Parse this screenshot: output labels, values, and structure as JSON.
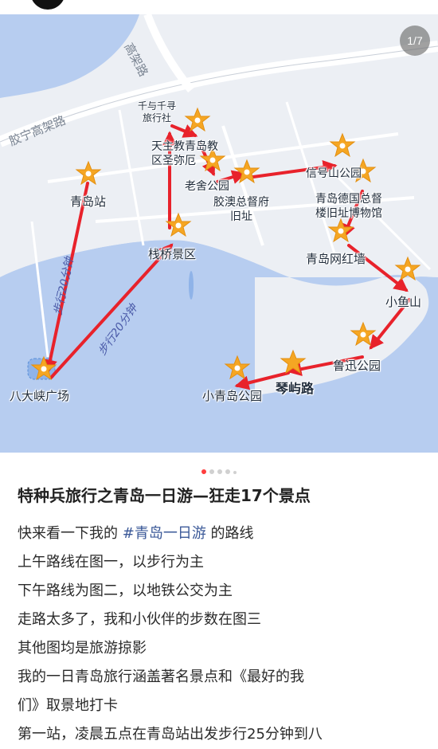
{
  "image_counter": "1/7",
  "map": {
    "roads": [
      "高架路",
      "胶宁高架路"
    ],
    "walk_labels": [
      "步行20分钟",
      "步行20分钟"
    ],
    "places": [
      {
        "name": "千与千寻\n旅行社"
      },
      {
        "name": "天主教青岛教\n区圣弥厄"
      },
      {
        "name": "老舍公园"
      },
      {
        "name": "胶澳总督府\n旧址"
      },
      {
        "name": "信号山公园"
      },
      {
        "name": "青岛德国总督\n楼旧址博物馆"
      },
      {
        "name": "青岛站"
      },
      {
        "name": "栈桥景区"
      },
      {
        "name": "青岛网红墙"
      },
      {
        "name": "小鱼山"
      },
      {
        "name": "鲁迅公园"
      },
      {
        "name": "琴屿路"
      },
      {
        "name": "小青岛公园"
      },
      {
        "name": "八大峡广场"
      }
    ],
    "icons": [
      "place-pin-icon",
      "route-arrow-icon"
    ],
    "colors": {
      "marker": "#f5a623",
      "arrow": "#e8222b",
      "water": "#b7cdf0",
      "land": "#eceff4"
    }
  },
  "carousel": {
    "count": 5,
    "active_index": 0
  },
  "post": {
    "title": "特种兵旅行之青岛一日游—狂走17个景点",
    "line1_prefix": "快来看一下我的 ",
    "hashtag": "#青岛一日游",
    "line1_suffix": " 的路线",
    "lines": [
      "上午路线在图一，以步行为主",
      "下午路线为图二，以地铁公交为主",
      "走路太多了，我和小伙伴的步数在图三",
      "其他图均是旅游掠影",
      "我的一日青岛旅行涵盖著名景点和《最好的我",
      "们》取景地打卡",
      "第一站，凌晨五点在青岛站出发步行25分钟到八"
    ]
  }
}
